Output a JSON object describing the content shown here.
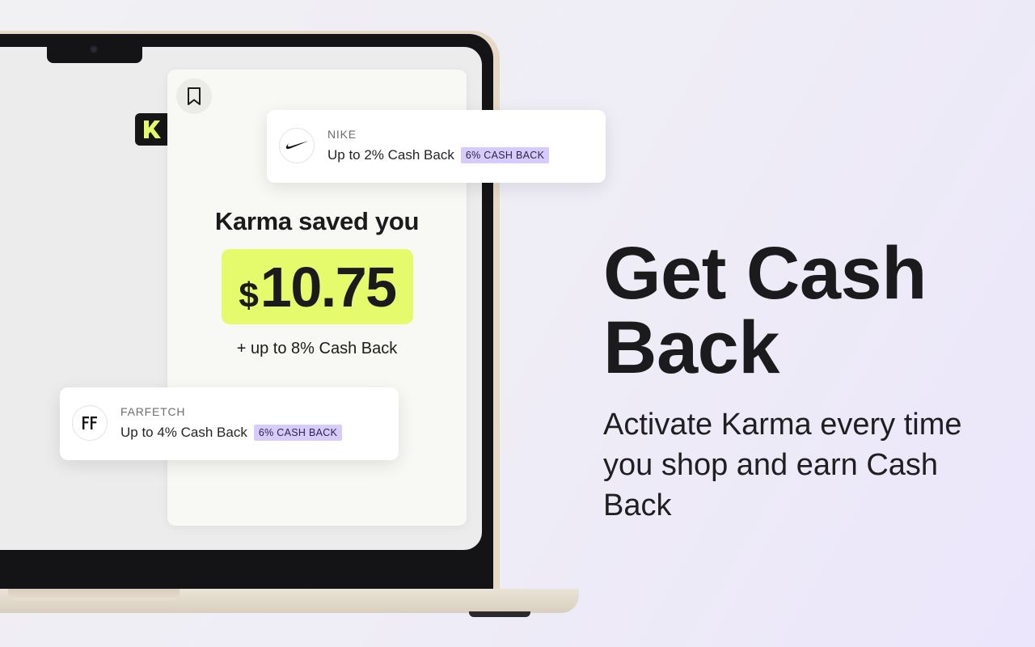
{
  "popup": {
    "saved_title": "Karma saved you",
    "amount_currency": "$",
    "amount_value": "10.75",
    "cashback_line": "+ up to 8% Cash Back"
  },
  "stores": [
    {
      "name": "NIKE",
      "offer": "Up to 2% Cash Back",
      "badge": "6% CASH BACK"
    },
    {
      "name": "FARFETCH",
      "offer": "Up to 4% Cash Back",
      "badge": "6% CASH BACK"
    }
  ],
  "promo": {
    "headline": "Get Cash Back",
    "subline": "Activate Karma every time you shop and earn Cash Back"
  },
  "colors": {
    "accent_yellow": "#e5fb6c",
    "badge_purple": "#d7cbfb",
    "logo_green": "#e5fb6c"
  },
  "icons": [
    "karma-logo-icon",
    "bookmark-icon",
    "nike-swoosh-icon",
    "farfetch-logo-icon"
  ]
}
